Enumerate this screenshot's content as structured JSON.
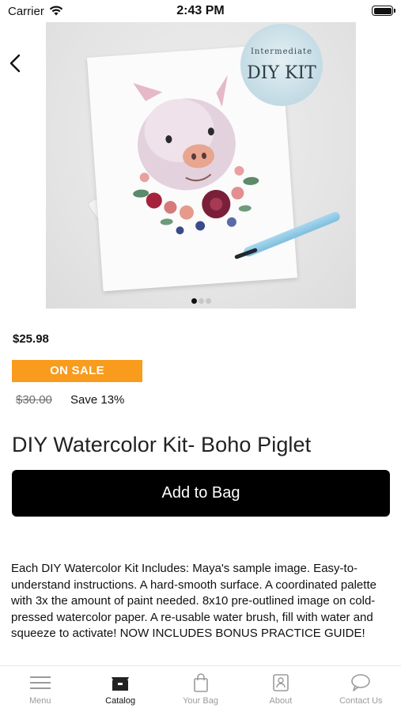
{
  "status_bar": {
    "carrier": "Carrier",
    "time": "2:43 PM"
  },
  "hero": {
    "badge_line1": "Intermediate",
    "badge_line2": "DIY KIT",
    "page_count": 3,
    "active_page": 1
  },
  "product": {
    "price": "$25.98",
    "sale_label": "ON SALE",
    "old_price": "$30.00",
    "save_text": "Save 13%",
    "title": "DIY Watercolor Kit- Boho Piglet",
    "add_button": "Add to Bag",
    "description": "Each DIY Watercolor Kit Includes: Maya's sample image. Easy-to-understand instructions. A hard-smooth surface. A coordinated palette with 3x the amount of paint needed. 8x10 pre-outlined image on cold-pressed watercolor paper. A re-usable water brush, fill with water and squeeze to activate! NOW INCLUDES BONUS PRACTICE GUIDE!"
  },
  "tabbar": {
    "tabs": [
      {
        "label": "Menu",
        "icon": "menu-icon"
      },
      {
        "label": "Catalog",
        "icon": "catalog-icon",
        "active": true
      },
      {
        "label": "Your Bag",
        "icon": "bag-icon"
      },
      {
        "label": "About",
        "icon": "about-icon"
      },
      {
        "label": "Contact Us",
        "icon": "chat-icon"
      }
    ]
  },
  "colors": {
    "sale": "#f99b1c",
    "button": "#000000",
    "inactive_tab": "#9b9b9b"
  }
}
